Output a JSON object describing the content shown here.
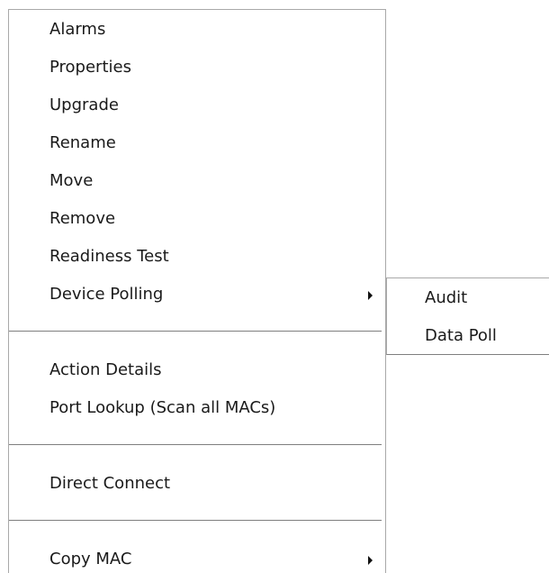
{
  "context_menu": {
    "items": [
      {
        "label": "Alarms"
      },
      {
        "label": "Properties"
      },
      {
        "label": "Upgrade"
      },
      {
        "label": "Rename"
      },
      {
        "label": "Move"
      },
      {
        "label": "Remove"
      },
      {
        "label": "Readiness Test"
      },
      {
        "label": "Device Polling"
      },
      {
        "label": "Action Details"
      },
      {
        "label": "Port Lookup (Scan all MACs)"
      },
      {
        "label": "Direct Connect"
      },
      {
        "label": "Copy MAC"
      }
    ],
    "submenu_arrow_icon": "triangle-right-icon"
  },
  "device_polling_submenu": {
    "items": [
      {
        "label": "Audit"
      },
      {
        "label": "Data Poll"
      }
    ]
  }
}
